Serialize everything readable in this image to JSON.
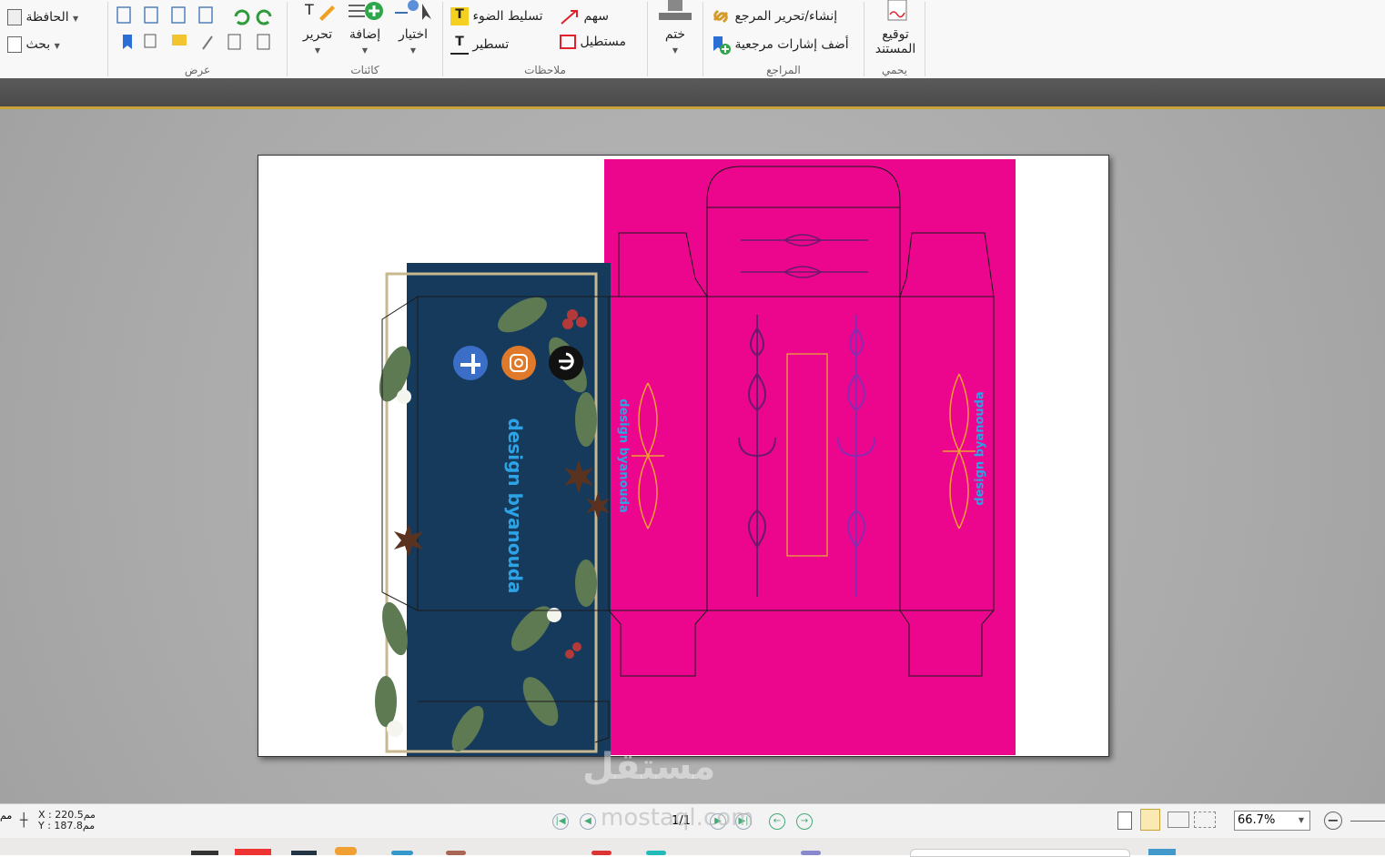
{
  "ribbon": {
    "clipboard_group": {
      "clipboard_label": "الحافظة",
      "search_label": "بحث",
      "group_label": "عرض"
    },
    "objects_group": {
      "edit_label": "تحرير",
      "add_label": "إضافة",
      "select_label": "اختيار",
      "group_label": "كائنات"
    },
    "comments_group": {
      "highlight_label": "تسليط الضوء",
      "arrow_label": "سهم",
      "underline_label": "تسطير",
      "rectangle_label": "مستطيل",
      "group_label": "ملاحظات"
    },
    "stamp_group": {
      "stamp_label": "ختم"
    },
    "references_group": {
      "create_edit_label": "إنشاء/تحرير المرجع",
      "add_bookmarks_label": "أضف إشارات مرجعية",
      "group_label": "المراجع"
    },
    "protect_group": {
      "sign_label_line1": "توقيع",
      "sign_label_line2": "المستند",
      "group_label": "يحمي"
    }
  },
  "document": {
    "brand_text_left": "design byanouda",
    "brand_text_mid": "design byanouda",
    "brand_text_right": "design byanouda",
    "colors": {
      "navy": "#163a5c",
      "magenta": "#ec068d",
      "brand_blue": "#2ba3e6",
      "purple": "#7a2aa0",
      "gold": "#e8a030"
    }
  },
  "statusbar": {
    "x_coord": "X : 220.5مم",
    "y_coord": "Y : 187.8مم",
    "unit_left": "مم",
    "page_indicator": "1/1",
    "zoom_value": "66.7%"
  },
  "watermark": {
    "arabic": "مستقل",
    "latin": "mostaql.com"
  }
}
